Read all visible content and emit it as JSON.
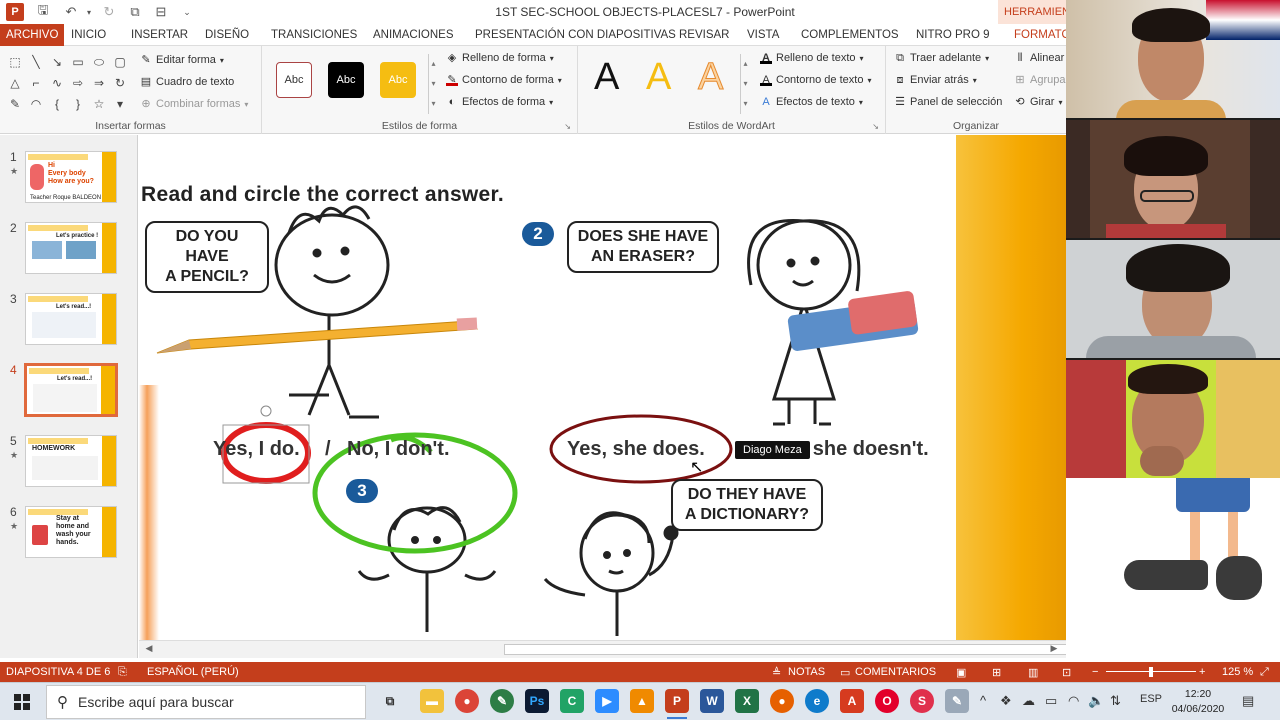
{
  "window": {
    "title": "1ST SEC-SCHOOL OBJECTS-PLACESL7 - PowerPoint",
    "context_tool": "HERRAMIENTAS DE DIBUJO"
  },
  "quick_access": [
    "save-icon",
    "undo-icon",
    "redo-icon",
    "start-presentation-icon",
    "customize-icon"
  ],
  "tabs": [
    {
      "label": "ARCHIVO"
    },
    {
      "label": "INICIO"
    },
    {
      "label": "INSERTAR"
    },
    {
      "label": "DISEÑO"
    },
    {
      "label": "TRANSICIONES"
    },
    {
      "label": "ANIMACIONES"
    },
    {
      "label": "PRESENTACIÓN CON DIAPOSITIVAS"
    },
    {
      "label": "REVISAR"
    },
    {
      "label": "VISTA"
    },
    {
      "label": "COMPLEMENTOS"
    },
    {
      "label": "NITRO PRO 9"
    },
    {
      "label": "FORMATO"
    }
  ],
  "ribbon": {
    "insert_shapes": {
      "label": "Insertar formas",
      "edit_shape": "Editar forma",
      "text_box": "Cuadro de texto",
      "merge_shapes": "Combinar formas"
    },
    "shape_styles": {
      "label": "Estilos de forma",
      "preset": "Abc",
      "fill": "Relleno de forma",
      "outline": "Contorno de forma",
      "effects": "Efectos de forma"
    },
    "wordart": {
      "label": "Estilos de WordArt",
      "letter": "A",
      "text_fill": "Relleno de texto",
      "text_outline": "Contorno de texto",
      "text_effects": "Efectos de texto"
    },
    "arrange": {
      "label": "Organizar",
      "bring_forward": "Traer adelante",
      "send_backward": "Enviar atrás",
      "selection_pane": "Panel de selección",
      "align": "Alinear",
      "group": "Agrupar",
      "rotate": "Girar"
    }
  },
  "thumbnails": [
    {
      "num": "1",
      "star": "★",
      "school": "I.E.P \"DON BOSCO\"",
      "text": "Hi\nEvery body\nHow are you?",
      "footer": "Teacher Roque BALDEON"
    },
    {
      "num": "2",
      "star": "",
      "school": "I.E.P \"DON BOSCO\"",
      "text": "Let's practice !",
      "footer": ""
    },
    {
      "num": "3",
      "star": "",
      "school": "I.E.P \"DON BOSCO\"",
      "text": "Let's read...!",
      "footer": ""
    },
    {
      "num": "4",
      "star": "",
      "school": "I.E.P \"DON BOSCO\"",
      "text": "Let's read...!",
      "footer": ""
    },
    {
      "num": "5",
      "star": "★",
      "school": "I.E.P \"DON BOSCO\"",
      "text": "HOMEWORK",
      "footer": ""
    },
    {
      "num": "6",
      "star": "★",
      "school": "I.E.P \"DON BOSCO\"",
      "text": "Stay at\nhome and\nwash your\nhands.",
      "footer": ""
    }
  ],
  "slide": {
    "instruction": "Read and circle the correct answer.",
    "q1": "DO YOU HAVE\nA PENCIL?",
    "q2": "DOES SHE HAVE\nAN ERASER?",
    "q3": "DO THEY HAVE\nA DICTIONARY?",
    "badge2": "2",
    "badge3": "3",
    "a1_yes": "Yes, I do.",
    "a1_sep": "/",
    "a1_no": "No, I don't.",
    "a2_yes": "Yes, she does.",
    "a2_no": "No, she doesn't.",
    "tooltip": "Diago Meza"
  },
  "status": {
    "slide_info": "DIAPOSITIVA 4 DE 6",
    "language": "ESPAÑOL (PERÚ)",
    "notes": "NOTAS",
    "comments": "COMENTARIOS",
    "zoom": "125 %"
  },
  "taskbar": {
    "search_placeholder": "Escribe aquí para buscar",
    "lang": "ESP",
    "time": "12:20",
    "date": "04/06/2020"
  },
  "colors": {
    "accent": "#c43e1c",
    "slide_band": "#f5a800",
    "red_circle": "#e01e1e",
    "green_circle": "#4cc322",
    "maroon_circle": "#7a1010",
    "badge": "#1a5a9a"
  }
}
